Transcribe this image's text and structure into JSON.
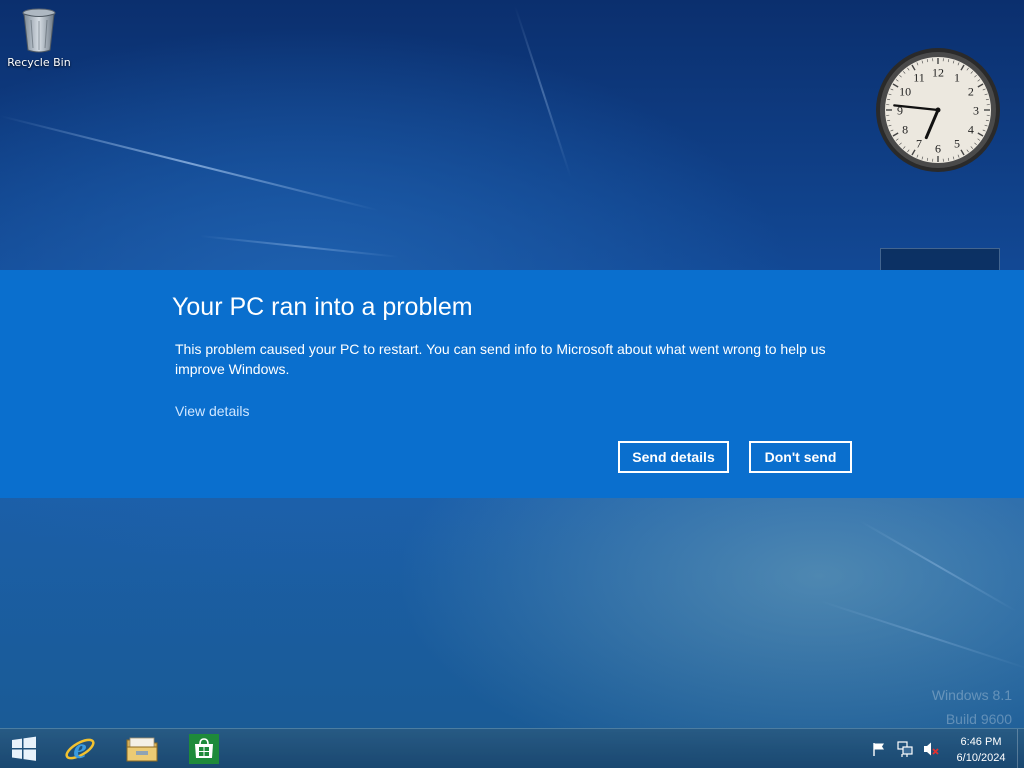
{
  "desktop": {
    "icons": [
      {
        "label": "Recycle Bin",
        "icon": "recycle-bin-icon"
      }
    ],
    "watermark": {
      "line1": "Windows 8.1",
      "line2": "Build 9600"
    },
    "clock_gadget": {
      "time": "6:46",
      "numerals": [
        "12",
        "1",
        "2",
        "3",
        "4",
        "5",
        "6",
        "7",
        "8",
        "9",
        "10",
        "11"
      ]
    }
  },
  "error_dialog": {
    "title": "Your PC ran into a problem",
    "message": "This problem caused your PC to restart. You can send info to Microsoft about what went wrong to help us improve Windows.",
    "view_details_link": "View details",
    "buttons": {
      "send": "Send details",
      "dont_send": "Don't send"
    },
    "background_color": "#0a6fce"
  },
  "taskbar": {
    "pinned": [
      {
        "name": "start",
        "icon": "windows-logo-icon"
      },
      {
        "name": "internet-explorer",
        "icon": "internet-explorer-icon"
      },
      {
        "name": "file-explorer",
        "icon": "folder-icon"
      },
      {
        "name": "store",
        "icon": "store-icon"
      }
    ],
    "tray": {
      "icons": [
        "action-center-flag-icon",
        "network-icon",
        "volume-muted-icon"
      ],
      "time": "6:46 PM",
      "date": "6/10/2024"
    }
  }
}
